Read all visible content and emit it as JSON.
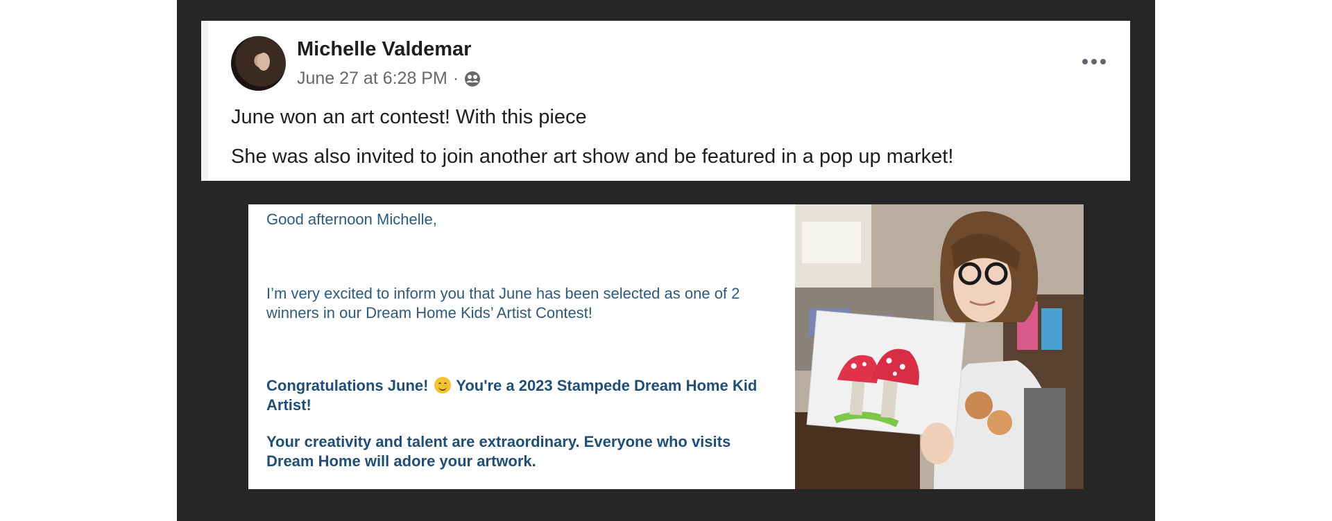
{
  "post": {
    "author": "Michelle Valdemar",
    "timestamp": "June 27 at 6:28 PM",
    "separator": "·",
    "audience_icon": "friends-icon",
    "text_line1": "June won an art contest! With this piece",
    "text_line2": "She was also invited to join another art show and be featured in a pop up market!"
  },
  "letter": {
    "greeting": "Good afternoon Michelle,",
    "body": "I’m very excited to inform you that June has been selected as one of 2 winners in our Dream Home Kids’ Artist Contest!",
    "congrats_part1": "Congratulations June!",
    "congrats_part2": "You're a 2023 Stampede Dream Home Kid Artist!",
    "creativity": "Your creativity and talent are extraordinary. Everyone who visits Dream Home will adore your artwork."
  },
  "colors": {
    "stage_bg": "#262626",
    "letter_text": "#2c5a7f",
    "letter_bold": "#1f4e79"
  }
}
